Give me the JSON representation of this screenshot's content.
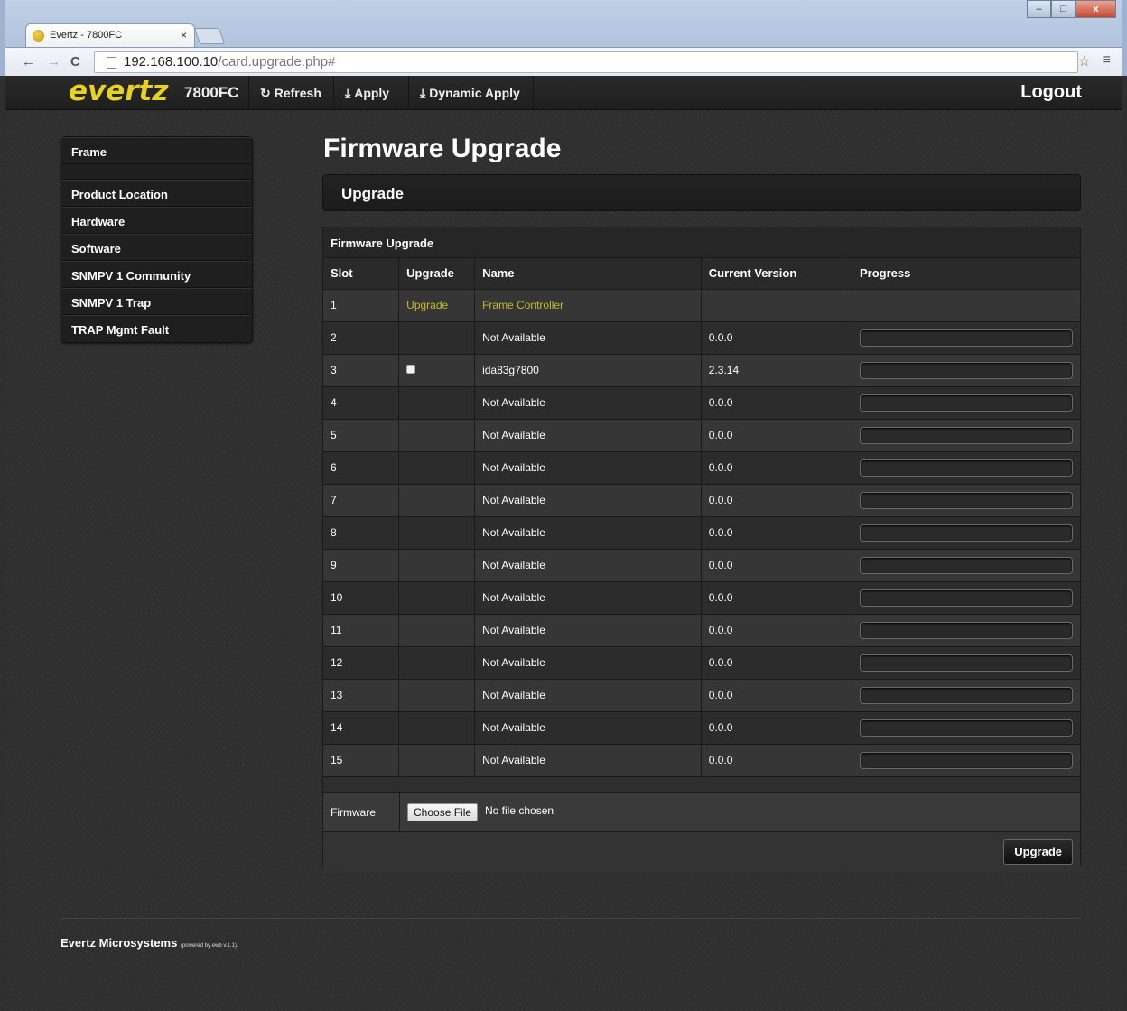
{
  "browser": {
    "tab_title": "Evertz - 7800FC",
    "tab_close": "×",
    "url_host": "192.168.100.10",
    "url_path": "/card.upgrade.php#",
    "back": "←",
    "forward": "→",
    "reload": "C",
    "star": "☆",
    "menu": "≡",
    "win_min": "–",
    "win_max": "□",
    "win_close": "x"
  },
  "topbar": {
    "logo": "evertz",
    "model": "7800FC",
    "refresh": "Refresh",
    "apply": "Apply",
    "dynamic_apply": "Dynamic Apply",
    "logout": "Logout",
    "refresh_icon": "refresh-icon",
    "apply_icon": "download-arrow-icon"
  },
  "sidebar": {
    "items": [
      "Frame",
      "Product Location",
      "Hardware",
      "Software",
      "SNMPV 1 Community",
      "SNMPV 1 Trap",
      "TRAP Mgmt Fault"
    ]
  },
  "page": {
    "title": "Firmware Upgrade",
    "panel_title": "Upgrade",
    "section_title": "Firmware Upgrade"
  },
  "table": {
    "headers": [
      "Slot",
      "Upgrade",
      "Name",
      "Current Version",
      "Progress"
    ],
    "rows": [
      {
        "slot": "1",
        "upgrade": "Upgrade",
        "name": "Frame Controller",
        "version": "",
        "progress": null
      },
      {
        "slot": "2",
        "upgrade": "",
        "name": "Not Available",
        "version": "0.0.0",
        "progress": 0
      },
      {
        "slot": "3",
        "upgrade": "checkbox",
        "name": "ida83g7800",
        "version": "2.3.14",
        "progress": 0
      },
      {
        "slot": "4",
        "upgrade": "",
        "name": "Not Available",
        "version": "0.0.0",
        "progress": 0
      },
      {
        "slot": "5",
        "upgrade": "",
        "name": "Not Available",
        "version": "0.0.0",
        "progress": 0
      },
      {
        "slot": "6",
        "upgrade": "",
        "name": "Not Available",
        "version": "0.0.0",
        "progress": 0
      },
      {
        "slot": "7",
        "upgrade": "",
        "name": "Not Available",
        "version": "0.0.0",
        "progress": 0
      },
      {
        "slot": "8",
        "upgrade": "",
        "name": "Not Available",
        "version": "0.0.0",
        "progress": 0
      },
      {
        "slot": "9",
        "upgrade": "",
        "name": "Not Available",
        "version": "0.0.0",
        "progress": 0
      },
      {
        "slot": "10",
        "upgrade": "",
        "name": "Not Available",
        "version": "0.0.0",
        "progress": 0
      },
      {
        "slot": "11",
        "upgrade": "",
        "name": "Not Available",
        "version": "0.0.0",
        "progress": 0
      },
      {
        "slot": "12",
        "upgrade": "",
        "name": "Not Available",
        "version": "0.0.0",
        "progress": 0
      },
      {
        "slot": "13",
        "upgrade": "",
        "name": "Not Available",
        "version": "0.0.0",
        "progress": 0
      },
      {
        "slot": "14",
        "upgrade": "",
        "name": "Not Available",
        "version": "0.0.0",
        "progress": 0
      },
      {
        "slot": "15",
        "upgrade": "",
        "name": "Not Available",
        "version": "0.0.0",
        "progress": 0
      }
    ]
  },
  "firmware": {
    "label": "Firmware",
    "choose_button": "Choose File",
    "no_file": "No file chosen",
    "upgrade_button": "Upgrade"
  },
  "footer": {
    "company": "Evertz Microsystems",
    "powered": "(powered by ewb v.1.1)."
  },
  "colors": {
    "accent_gold": "#c6b928",
    "logo_yellow": "#e6d21f",
    "background": "#2f2f2f"
  }
}
